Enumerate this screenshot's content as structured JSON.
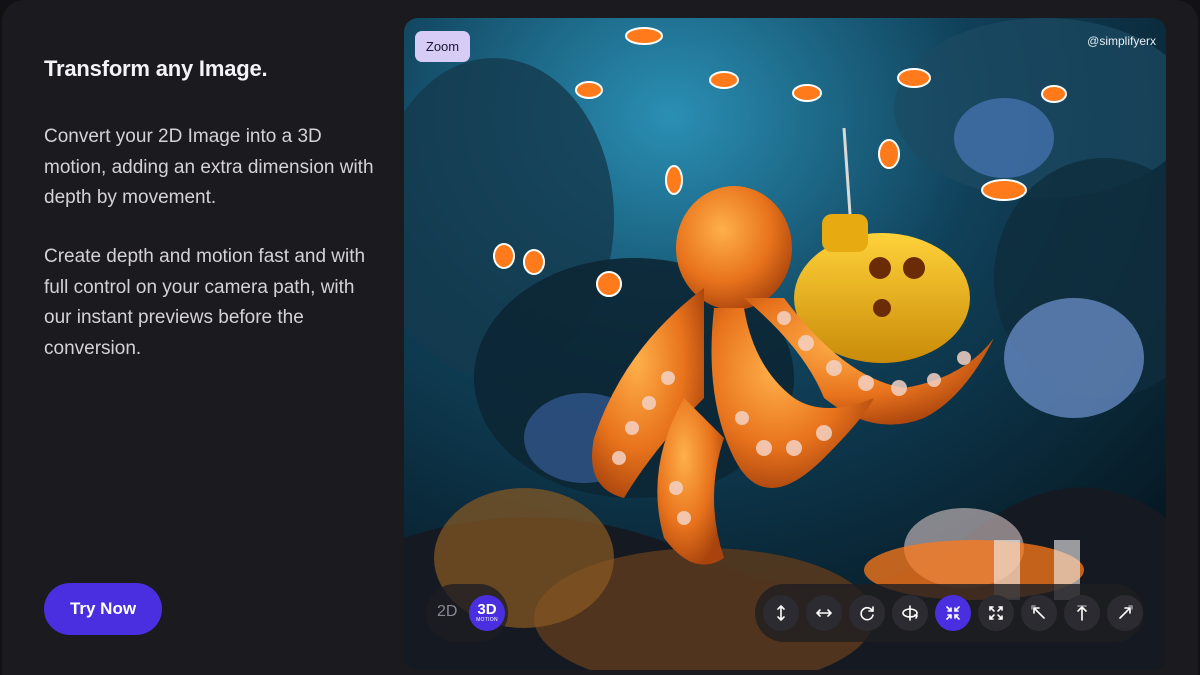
{
  "hero": {
    "title": "Transform any Image.",
    "paragraph_1": "Convert your 2D Image into a 3D motion, adding an extra dimension with depth by movement.",
    "paragraph_2": "Create depth and motion fast and with full control on your camera path, with our instant previews before the conversion.",
    "cta_label": "Try Now"
  },
  "viewer": {
    "zoom_label": "Zoom",
    "watermark": "@simplifyerx",
    "mode_toggle": {
      "option_2d": "2D",
      "option_3d": "3D",
      "option_3d_caption": "MOTION",
      "selected": "3D"
    },
    "camera_tools": [
      {
        "icon": "vertical-move-icon",
        "active": false
      },
      {
        "icon": "horizontal-move-icon",
        "active": false
      },
      {
        "icon": "rotate-icon",
        "active": false
      },
      {
        "icon": "orbit-icon",
        "active": false
      },
      {
        "icon": "zoom-in-icon",
        "active": true
      },
      {
        "icon": "zoom-out-icon",
        "active": false
      },
      {
        "icon": "arrow-up-left-icon",
        "active": false
      },
      {
        "icon": "arrow-up-icon",
        "active": false
      },
      {
        "icon": "arrow-up-right-icon",
        "active": false
      }
    ]
  },
  "colors": {
    "accent": "#4a2fe0",
    "zoom_badge": "#d6ccf5",
    "background": "#1b1a1e"
  }
}
